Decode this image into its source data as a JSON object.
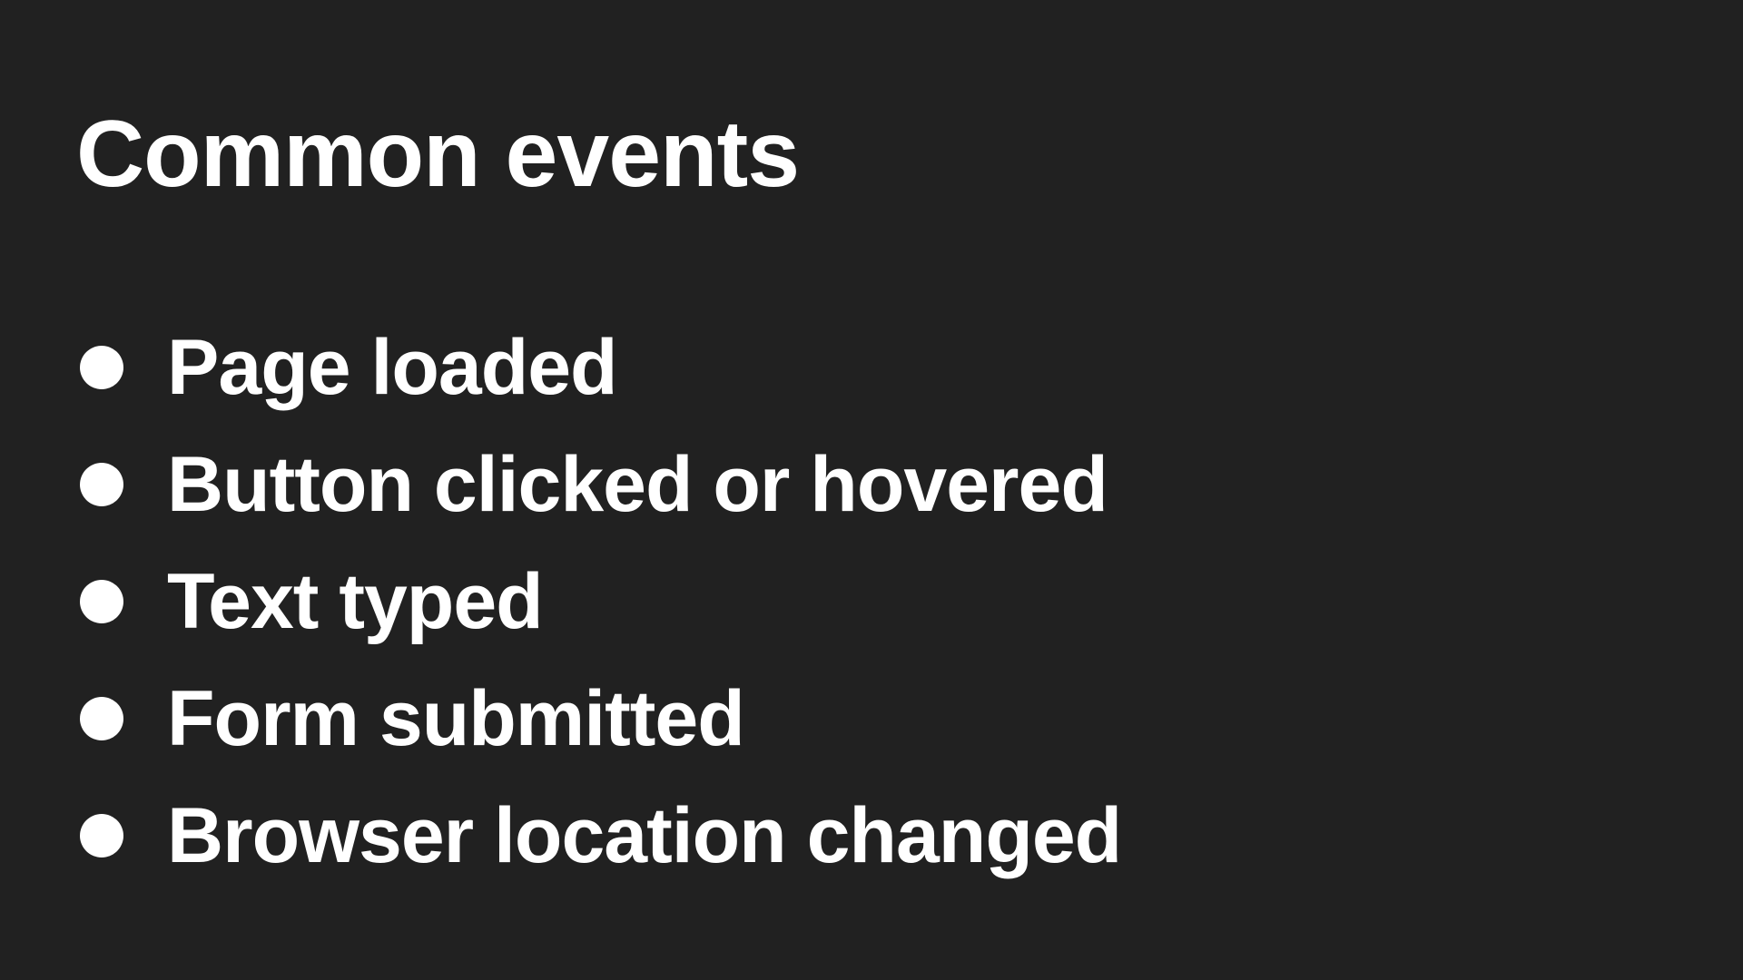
{
  "slide": {
    "title": "Common events",
    "bullets": [
      "Page loaded",
      "Button clicked or hovered",
      "Text typed",
      "Form submitted",
      "Browser location changed"
    ]
  },
  "colors": {
    "background": "#212121",
    "text": "#ffffff"
  }
}
